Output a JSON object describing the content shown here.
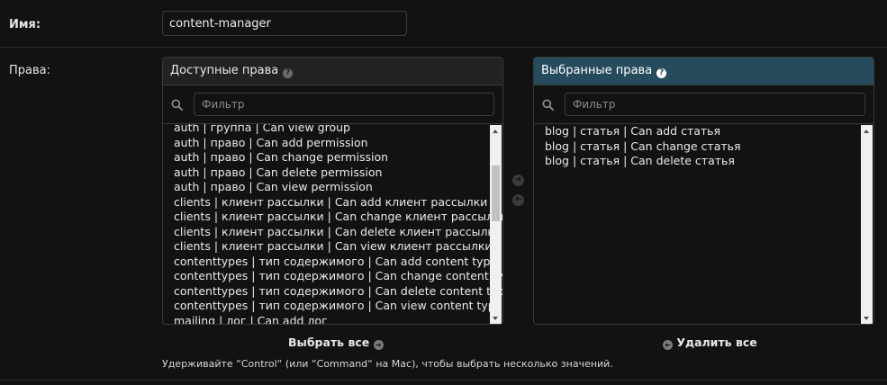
{
  "name_field": {
    "label": "Имя:",
    "value": "content-manager"
  },
  "perms_label": "Права:",
  "available": {
    "title": "Доступные права",
    "filter_placeholder": "Фильтр",
    "items": [
      "auth | группа | Can view group",
      "auth | право | Can add permission",
      "auth | право | Can change permission",
      "auth | право | Can delete permission",
      "auth | право | Can view permission",
      "clients | клиент рассылки | Can add клиент рассылки",
      "clients | клиент рассылки | Can change клиент рассылки",
      "clients | клиент рассылки | Can delete клиент рассылки",
      "clients | клиент рассылки | Can view клиент рассылки",
      "contenttypes | тип содержимого | Can add content type",
      "contenttypes | тип содержимого | Can change content type",
      "contenttypes | тип содержимого | Can delete content type",
      "contenttypes | тип содержимого | Can view content type",
      "mailing | лог | Can add лог"
    ]
  },
  "chosen": {
    "title": "Выбранные права",
    "filter_placeholder": "Фильтр",
    "items": [
      "blog | статья | Can add статья",
      "blog | статья | Can change статья",
      "blog | статья | Can delete статья"
    ]
  },
  "actions": {
    "choose_all": "Выбрать все",
    "remove_all": "Удалить все"
  },
  "help_text": "Удерживайте “Control“ (или “Command“ на Mac), чтобы выбрать несколько значений.",
  "colors": {
    "background": "#121212",
    "chosen_header": "#264b5d"
  },
  "icons": {
    "help": "question-circle-icon",
    "filter": "search-icon",
    "add": "arrow-right-icon",
    "remove": "arrow-left-icon"
  }
}
